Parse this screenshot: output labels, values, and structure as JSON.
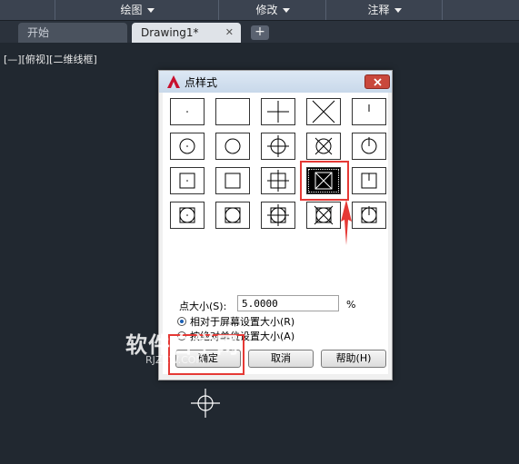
{
  "menubar": {
    "items": [
      {
        "label": "绘图"
      },
      {
        "label": "修改"
      },
      {
        "label": "注释"
      }
    ]
  },
  "tabs": {
    "start": "开始",
    "drawing": "Drawing1*",
    "close": "✕",
    "add": "+"
  },
  "viewport_label": "[—][俯视][二维线框]",
  "dialog": {
    "title": "点样式",
    "size_label": "点大小(S):",
    "size_value": "5.0000",
    "size_unit": "%",
    "radio_relative": "相对于屏幕设置大小(R)",
    "radio_absolute": "按绝对单位设置大小(A)",
    "ok": "确定",
    "cancel": "取消",
    "help": "帮助(H)",
    "selected_style": "square-circle-x-style"
  },
  "watermark": {
    "text": "软件自学网",
    "url": "RJZXW.COM"
  },
  "colors": {
    "accent": "#e53935",
    "background": "#212830",
    "menubar": "#3b4350"
  }
}
